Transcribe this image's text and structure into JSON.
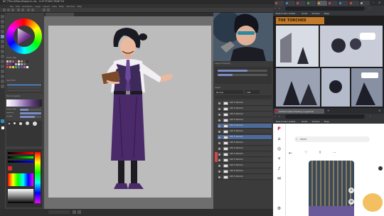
{
  "csp": {
    "title": "NP_TR3s-H0Bat-Widget-hl.clip - CLIP STUDIO PAINT EX",
    "menu": [
      "File",
      "Edit",
      "Animation",
      "Layer",
      "Select",
      "View",
      "Filter",
      "Window",
      "Help"
    ],
    "left_panels": {
      "sub_tool": "Sub Tool",
      "tool_property": "Tool property",
      "brush_size": "Brush Size",
      "opacity": "Opacity",
      "shape": "Shape",
      "color_set": "Color Set"
    },
    "right_panels": {
      "navigator": "Navigator",
      "layer_property": "Layer Property",
      "layer": "Layer",
      "blending": "Normal",
      "opacity_value": "100"
    },
    "layers": [
      {
        "name": "100 % Normal",
        "selected": false
      },
      {
        "name": "100 % Normal",
        "selected": false
      },
      {
        "name": "100 % Normal",
        "selected": false
      },
      {
        "name": "100 % Normal",
        "selected": false
      },
      {
        "name": "100 % Normal",
        "selected": true
      },
      {
        "name": "100 % Normal",
        "selected": false
      },
      {
        "name": "100 % Normal",
        "selected": true
      },
      {
        "name": "100 % Normal",
        "selected": false
      },
      {
        "name": "100 % Normal",
        "selected": false
      },
      {
        "name": "100 % Normal",
        "selected": false
      },
      {
        "name": "100 % Normal",
        "selected": false
      },
      {
        "name": "100 % Normal",
        "selected": false
      },
      {
        "name": "100 % Normal",
        "selected": false
      },
      {
        "name": "100 % Normal",
        "selected": false
      }
    ]
  },
  "browser_top": {
    "tabs": [
      "",
      "",
      "",
      "",
      "",
      "",
      "",
      "",
      ""
    ],
    "bookmarks": [
      "New-tinhalo-ld-Web...",
      "Gmail",
      "YouTube",
      "Maps"
    ],
    "comic_title": "THE TORCHED"
  },
  "browser_bottom": {
    "tab": "ArtbiDucaste Drawing in general",
    "bookmarks": [
      "New-tinhalo-ld-Web...",
      "Gmail",
      "YouTube",
      "Maps"
    ],
    "search": "diazni"
  },
  "colors": {
    "csp_bg": "#3a3a3a",
    "accent": "#4d6a98",
    "dress": "#4b2a6a"
  }
}
